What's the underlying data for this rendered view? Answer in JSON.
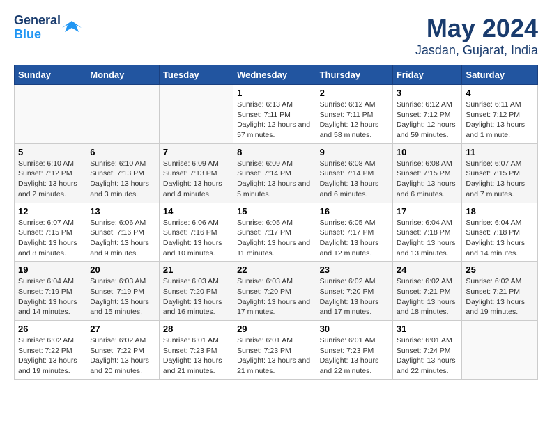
{
  "header": {
    "logo_line1": "General",
    "logo_line2": "Blue",
    "title": "May 2024",
    "subtitle": "Jasdan, Gujarat, India"
  },
  "days_of_week": [
    "Sunday",
    "Monday",
    "Tuesday",
    "Wednesday",
    "Thursday",
    "Friday",
    "Saturday"
  ],
  "weeks": [
    [
      {
        "day": "",
        "info": ""
      },
      {
        "day": "",
        "info": ""
      },
      {
        "day": "",
        "info": ""
      },
      {
        "day": "1",
        "info": "Sunrise: 6:13 AM\nSunset: 7:11 PM\nDaylight: 12 hours and 57 minutes."
      },
      {
        "day": "2",
        "info": "Sunrise: 6:12 AM\nSunset: 7:11 PM\nDaylight: 12 hours and 58 minutes."
      },
      {
        "day": "3",
        "info": "Sunrise: 6:12 AM\nSunset: 7:12 PM\nDaylight: 12 hours and 59 minutes."
      },
      {
        "day": "4",
        "info": "Sunrise: 6:11 AM\nSunset: 7:12 PM\nDaylight: 13 hours and 1 minute."
      }
    ],
    [
      {
        "day": "5",
        "info": "Sunrise: 6:10 AM\nSunset: 7:12 PM\nDaylight: 13 hours and 2 minutes."
      },
      {
        "day": "6",
        "info": "Sunrise: 6:10 AM\nSunset: 7:13 PM\nDaylight: 13 hours and 3 minutes."
      },
      {
        "day": "7",
        "info": "Sunrise: 6:09 AM\nSunset: 7:13 PM\nDaylight: 13 hours and 4 minutes."
      },
      {
        "day": "8",
        "info": "Sunrise: 6:09 AM\nSunset: 7:14 PM\nDaylight: 13 hours and 5 minutes."
      },
      {
        "day": "9",
        "info": "Sunrise: 6:08 AM\nSunset: 7:14 PM\nDaylight: 13 hours and 6 minutes."
      },
      {
        "day": "10",
        "info": "Sunrise: 6:08 AM\nSunset: 7:15 PM\nDaylight: 13 hours and 6 minutes."
      },
      {
        "day": "11",
        "info": "Sunrise: 6:07 AM\nSunset: 7:15 PM\nDaylight: 13 hours and 7 minutes."
      }
    ],
    [
      {
        "day": "12",
        "info": "Sunrise: 6:07 AM\nSunset: 7:15 PM\nDaylight: 13 hours and 8 minutes."
      },
      {
        "day": "13",
        "info": "Sunrise: 6:06 AM\nSunset: 7:16 PM\nDaylight: 13 hours and 9 minutes."
      },
      {
        "day": "14",
        "info": "Sunrise: 6:06 AM\nSunset: 7:16 PM\nDaylight: 13 hours and 10 minutes."
      },
      {
        "day": "15",
        "info": "Sunrise: 6:05 AM\nSunset: 7:17 PM\nDaylight: 13 hours and 11 minutes."
      },
      {
        "day": "16",
        "info": "Sunrise: 6:05 AM\nSunset: 7:17 PM\nDaylight: 13 hours and 12 minutes."
      },
      {
        "day": "17",
        "info": "Sunrise: 6:04 AM\nSunset: 7:18 PM\nDaylight: 13 hours and 13 minutes."
      },
      {
        "day": "18",
        "info": "Sunrise: 6:04 AM\nSunset: 7:18 PM\nDaylight: 13 hours and 14 minutes."
      }
    ],
    [
      {
        "day": "19",
        "info": "Sunrise: 6:04 AM\nSunset: 7:19 PM\nDaylight: 13 hours and 14 minutes."
      },
      {
        "day": "20",
        "info": "Sunrise: 6:03 AM\nSunset: 7:19 PM\nDaylight: 13 hours and 15 minutes."
      },
      {
        "day": "21",
        "info": "Sunrise: 6:03 AM\nSunset: 7:20 PM\nDaylight: 13 hours and 16 minutes."
      },
      {
        "day": "22",
        "info": "Sunrise: 6:03 AM\nSunset: 7:20 PM\nDaylight: 13 hours and 17 minutes."
      },
      {
        "day": "23",
        "info": "Sunrise: 6:02 AM\nSunset: 7:20 PM\nDaylight: 13 hours and 17 minutes."
      },
      {
        "day": "24",
        "info": "Sunrise: 6:02 AM\nSunset: 7:21 PM\nDaylight: 13 hours and 18 minutes."
      },
      {
        "day": "25",
        "info": "Sunrise: 6:02 AM\nSunset: 7:21 PM\nDaylight: 13 hours and 19 minutes."
      }
    ],
    [
      {
        "day": "26",
        "info": "Sunrise: 6:02 AM\nSunset: 7:22 PM\nDaylight: 13 hours and 19 minutes."
      },
      {
        "day": "27",
        "info": "Sunrise: 6:02 AM\nSunset: 7:22 PM\nDaylight: 13 hours and 20 minutes."
      },
      {
        "day": "28",
        "info": "Sunrise: 6:01 AM\nSunset: 7:23 PM\nDaylight: 13 hours and 21 minutes."
      },
      {
        "day": "29",
        "info": "Sunrise: 6:01 AM\nSunset: 7:23 PM\nDaylight: 13 hours and 21 minutes."
      },
      {
        "day": "30",
        "info": "Sunrise: 6:01 AM\nSunset: 7:23 PM\nDaylight: 13 hours and 22 minutes."
      },
      {
        "day": "31",
        "info": "Sunrise: 6:01 AM\nSunset: 7:24 PM\nDaylight: 13 hours and 22 minutes."
      },
      {
        "day": "",
        "info": ""
      }
    ]
  ]
}
